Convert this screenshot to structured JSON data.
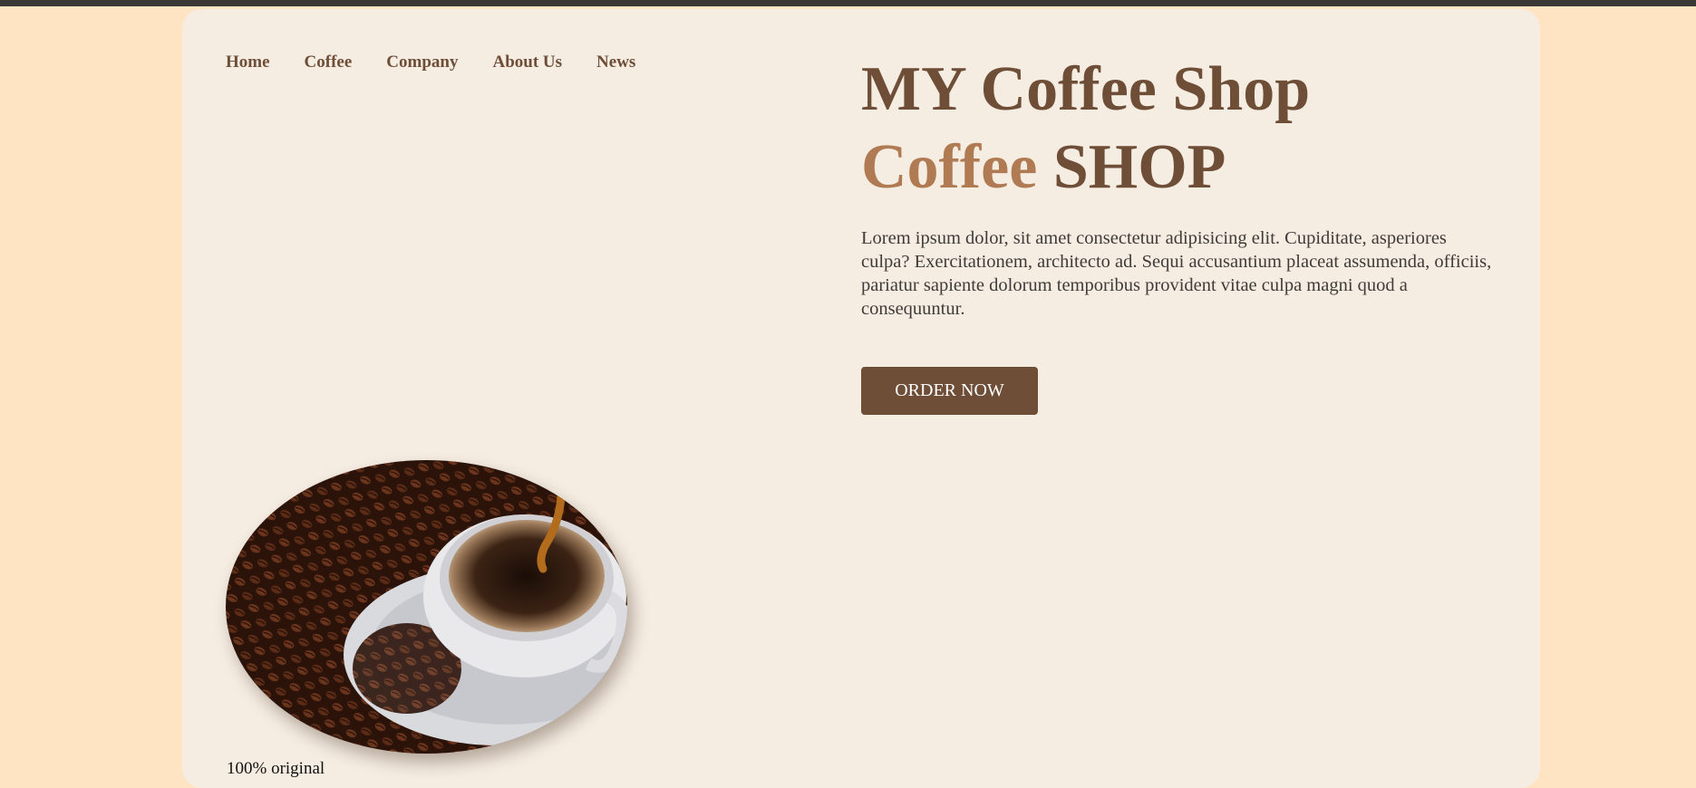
{
  "nav": {
    "items": [
      {
        "label": "Home"
      },
      {
        "label": "Coffee"
      },
      {
        "label": "Company"
      },
      {
        "label": "About Us"
      },
      {
        "label": "News"
      }
    ]
  },
  "hero": {
    "title_line1": "MY Coffee Shop",
    "title_line2_accent": "Coffee",
    "title_line2_rest": "SHOP",
    "description": "Lorem ipsum dolor, sit amet consectetur adipisicing elit. Cupiditate, asperiores culpa? Exercitationem, architecto ad. Sequi accusantium placeat assumenda, officiis, pariatur sapiente dolorum temporibus provident vitae culpa magni quod a consequuntur.",
    "order_button_label": "ORDER NOW"
  },
  "feature": {
    "image_alt": "coffee cup with beans",
    "caption": "100% original"
  },
  "colors": {
    "page_background": "#ffe4c4",
    "card_background": "#f5ece2",
    "brand_brown": "#6f4e37",
    "accent": "#b07a52",
    "top_strip": "#3b3936"
  }
}
